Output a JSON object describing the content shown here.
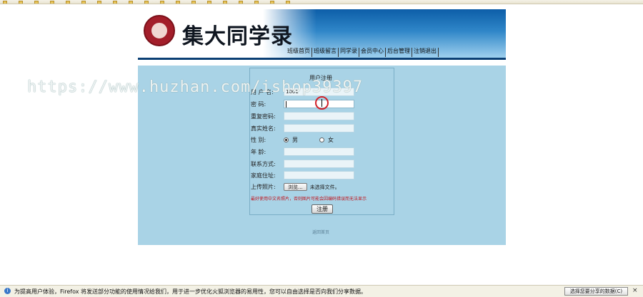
{
  "bookmarks": [
    "",
    "",
    "",
    "",
    "",
    "",
    "",
    "",
    "",
    "",
    "",
    "",
    "",
    "",
    "",
    "",
    "",
    "",
    ""
  ],
  "header": {
    "site_title": "集大同学录",
    "nav": [
      "班级首页",
      "班级留言",
      "同学录",
      "会员中心",
      "后台管理",
      "注销退出"
    ]
  },
  "form": {
    "title": "用户注册",
    "fields": [
      {
        "label": "用 户 名:",
        "value": "1001"
      },
      {
        "label": "密    码:",
        "value": ""
      },
      {
        "label": "重复密码:",
        "value": ""
      },
      {
        "label": "真实姓名:",
        "value": ""
      },
      {
        "label": "性    别:",
        "value": ""
      },
      {
        "label": "年    龄:",
        "value": ""
      },
      {
        "label": "联系方式:",
        "value": ""
      },
      {
        "label": "家庭住址:",
        "value": ""
      },
      {
        "label": "上传照片:",
        "value": ""
      }
    ],
    "gender_options": [
      "男",
      "女"
    ],
    "gender_selected": "男",
    "file_button": "浏览...",
    "file_status": "未选择文件。",
    "hint": "最好使用中文名照片，否则图片可能会因编码错误而无法显示",
    "submit_label": "注册",
    "footer_link": "返回首页"
  },
  "watermark": "https://www.huzhan.com/ishop39397",
  "notification": {
    "text": "为提高用户体验，Firefox 将发送部分功能的使用情况给我们，用于进一步优化火狐浏览器的易用性，您可以自由选择是否向我们分享数据。",
    "button": "选择您要分享的数据(C)",
    "close": "×"
  },
  "colors": {
    "panel": "#a9d3e6",
    "banner": "#0d5ea8",
    "hint": "#c0141d"
  }
}
